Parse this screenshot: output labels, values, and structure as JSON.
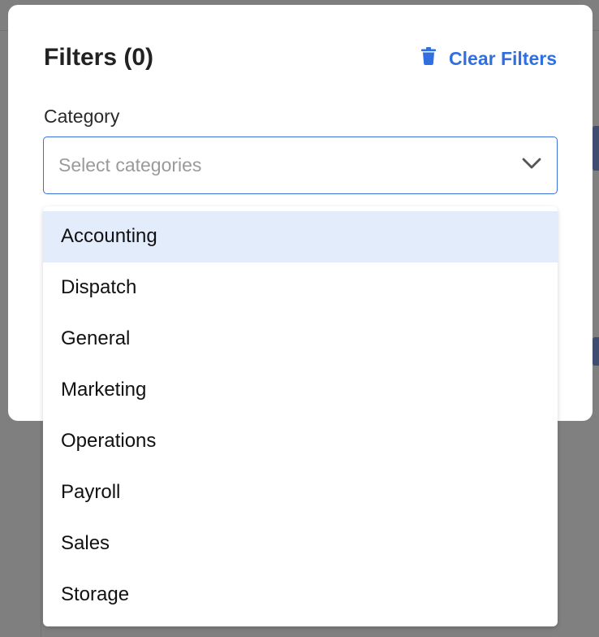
{
  "modal": {
    "title": "Filters (0)",
    "clear_label": "Clear Filters",
    "category_label": "Category",
    "category_placeholder": "Select categories"
  },
  "dropdown": {
    "options": [
      "Accounting",
      "Dispatch",
      "General",
      "Marketing",
      "Operations",
      "Payroll",
      "Sales",
      "Storage"
    ],
    "highlighted": "Accounting"
  },
  "colors": {
    "accent": "#2f6fe0",
    "highlight": "#e3ecfb",
    "overlay": "#7f7f7f"
  },
  "icons": {
    "clear": "trash-icon",
    "select": "chevron-down-icon"
  }
}
